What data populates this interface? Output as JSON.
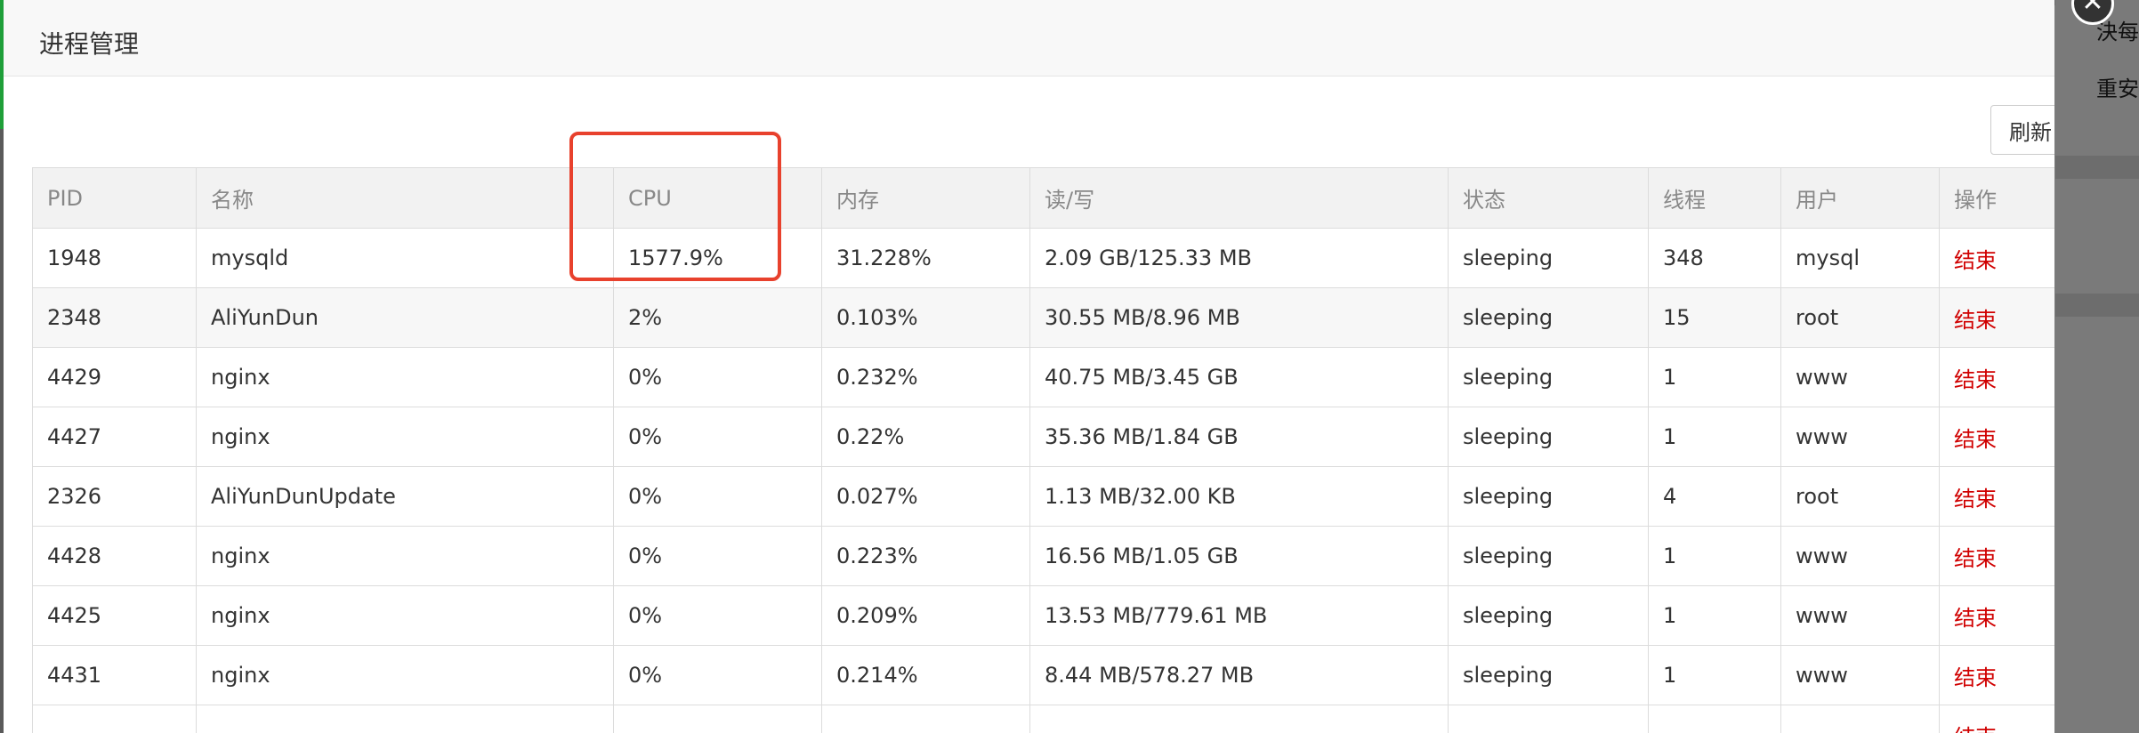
{
  "background": {
    "right_texts": [
      "決每",
      "重安"
    ]
  },
  "dialog": {
    "title": "进程管理",
    "refresh_label": "刷新",
    "close_icon": "close-icon"
  },
  "table": {
    "columns": [
      "PID",
      "名称",
      "CPU",
      "内存",
      "读/写",
      "状态",
      "线程",
      "用户",
      "操作"
    ],
    "rows": [
      {
        "pid": "1948",
        "name": "mysqld",
        "cpu": "1577.9%",
        "mem": "31.228%",
        "io": "2.09 GB/125.33 MB",
        "status": "sleeping",
        "threads": "348",
        "user": "mysql",
        "action": "结束"
      },
      {
        "pid": "2348",
        "name": "AliYunDun",
        "cpu": "2%",
        "mem": "0.103%",
        "io": "30.55 MB/8.96 MB",
        "status": "sleeping",
        "threads": "15",
        "user": "root",
        "action": "结束"
      },
      {
        "pid": "4429",
        "name": "nginx",
        "cpu": "0%",
        "mem": "0.232%",
        "io": "40.75 MB/3.45 GB",
        "status": "sleeping",
        "threads": "1",
        "user": "www",
        "action": "结束"
      },
      {
        "pid": "4427",
        "name": "nginx",
        "cpu": "0%",
        "mem": "0.22%",
        "io": "35.36 MB/1.84 GB",
        "status": "sleeping",
        "threads": "1",
        "user": "www",
        "action": "结束"
      },
      {
        "pid": "2326",
        "name": "AliYunDunUpdate",
        "cpu": "0%",
        "mem": "0.027%",
        "io": "1.13 MB/32.00 KB",
        "status": "sleeping",
        "threads": "4",
        "user": "root",
        "action": "结束"
      },
      {
        "pid": "4428",
        "name": "nginx",
        "cpu": "0%",
        "mem": "0.223%",
        "io": "16.56 MB/1.05 GB",
        "status": "sleeping",
        "threads": "1",
        "user": "www",
        "action": "结束"
      },
      {
        "pid": "4425",
        "name": "nginx",
        "cpu": "0%",
        "mem": "0.209%",
        "io": "13.53 MB/779.61 MB",
        "status": "sleeping",
        "threads": "1",
        "user": "www",
        "action": "结束"
      },
      {
        "pid": "4431",
        "name": "nginx",
        "cpu": "0%",
        "mem": "0.214%",
        "io": "8.44 MB/578.27 MB",
        "status": "sleeping",
        "threads": "1",
        "user": "www",
        "action": "结束"
      },
      {
        "pid": "",
        "name": "",
        "cpu": "",
        "mem": "",
        "io": "",
        "status": "",
        "threads": "",
        "user": "",
        "action": "结束"
      }
    ]
  },
  "colors": {
    "kill_action": "#d00000",
    "highlight_box": "#e8412d"
  }
}
